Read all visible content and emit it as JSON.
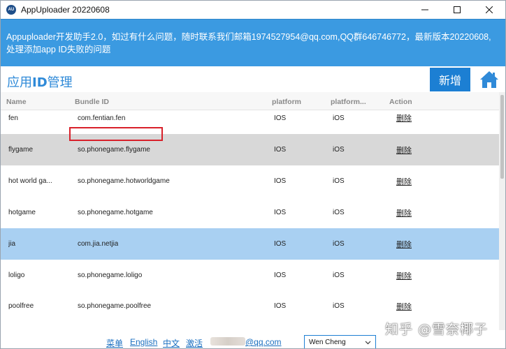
{
  "window": {
    "title": "AppUploader 20220608",
    "icon_text": "AU"
  },
  "banner": {
    "text": "Appuploader开发助手2.0，如过有什么问题，随时联系我们邮箱1974527954@qq.com,QQ群646746772，最新版本20220608,处理添加app ID失败的问题"
  },
  "header": {
    "title_prefix": "应用",
    "title_bold": "ID",
    "title_suffix": "管理",
    "add_label": "新增",
    "home_icon": "home-icon"
  },
  "table": {
    "columns": [
      "Name",
      "Bundle ID",
      "platform",
      "platform...",
      "Action"
    ],
    "rows": [
      {
        "name": "fen",
        "bundle": "com.fentian.fen",
        "platform": "IOS",
        "platform2": "iOS",
        "action": "删除"
      },
      {
        "name": "flygame",
        "bundle": "so.phonegame.flygame",
        "platform": "IOS",
        "platform2": "iOS",
        "action": "删除"
      },
      {
        "name": "hot world ga...",
        "bundle": "so.phonegame.hotworldgame",
        "platform": "IOS",
        "platform2": "iOS",
        "action": "删除"
      },
      {
        "name": "hotgame",
        "bundle": "so.phonegame.hotgame",
        "platform": "IOS",
        "platform2": "iOS",
        "action": "删除"
      },
      {
        "name": "jia",
        "bundle": "com.jia.netjia",
        "platform": "IOS",
        "platform2": "iOS",
        "action": "删除"
      },
      {
        "name": "loligo",
        "bundle": "so.phonegame.loligo",
        "platform": "IOS",
        "platform2": "iOS",
        "action": "删除"
      },
      {
        "name": "poolfree",
        "bundle": "so.phonegame.poolfree",
        "platform": "IOS",
        "platform2": "iOS",
        "action": "删除"
      }
    ]
  },
  "footer": {
    "menu": "菜单",
    "english": "English",
    "chinese": "中文",
    "activate": "激活",
    "email_suffix": "@qq.com",
    "user_select": "Wen Cheng"
  },
  "watermark": "知乎 @雪奈椰子",
  "colors": {
    "banner": "#3b9ae1",
    "accent": "#1c7fd3",
    "selected_row": "#a9d0f2",
    "alt_row": "#d8d8d8",
    "highlight_box": "#d8202a"
  }
}
